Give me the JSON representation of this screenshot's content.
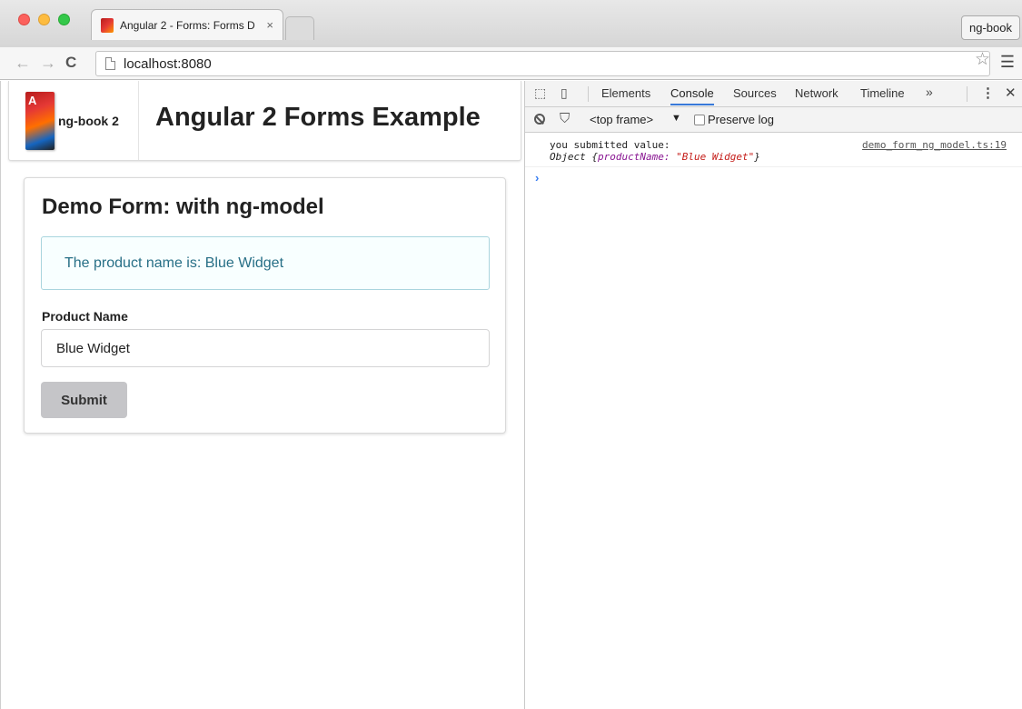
{
  "browser": {
    "tab_title": "Angular 2 - Forms: Forms D",
    "tab_close": "×",
    "profile": "ng-book",
    "url": "localhost:8080",
    "nav": {
      "back": "←",
      "forward": "→",
      "reload": "C"
    }
  },
  "app": {
    "brand": "ng-book 2",
    "title": "Angular 2 Forms Example",
    "card_title": "Demo Form: with ng-model",
    "info_text": "The product name is: Blue Widget",
    "field_label": "Product Name",
    "field_value": "Blue Widget",
    "submit_label": "Submit"
  },
  "devtools": {
    "tabs": [
      {
        "label": "Elements",
        "active": false
      },
      {
        "label": "Console",
        "active": true
      },
      {
        "label": "Sources",
        "active": false
      },
      {
        "label": "Network",
        "active": false
      },
      {
        "label": "Timeline",
        "active": false
      }
    ],
    "more": "»",
    "frame": "<top frame>",
    "frame_arrow": "▼",
    "preserve_log": "Preserve log",
    "console": {
      "line1": "you submitted value:",
      "source": "demo_form_ng_model.ts:19",
      "obj_prefix": "Object {",
      "obj_key": "productName:",
      "obj_value": "\"Blue Widget\"",
      "obj_suffix": "}"
    },
    "prompt": "›"
  },
  "colors": {
    "accent": "#3879d9",
    "info_text": "#276f86",
    "info_border": "#a9d5de"
  }
}
